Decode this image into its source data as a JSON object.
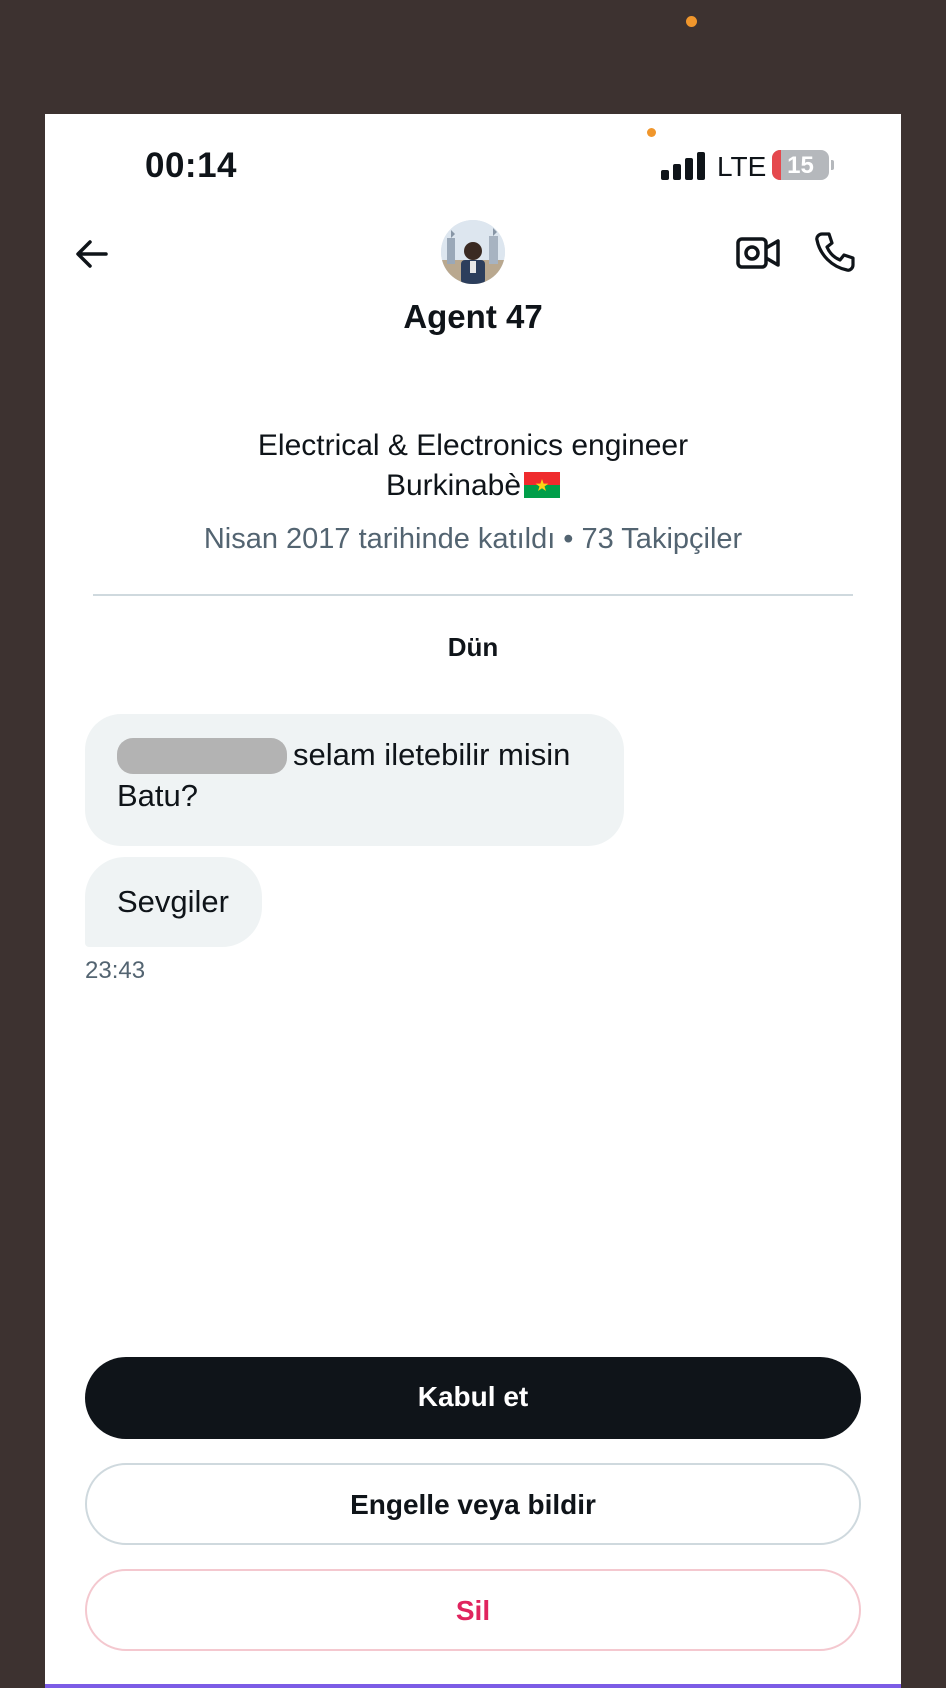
{
  "status_bar": {
    "time": "00:14",
    "network": "LTE",
    "battery_level": "15",
    "battery_fraction": 0.16
  },
  "header": {
    "back_icon": "arrow-left-icon",
    "video_icon": "video-camera-icon",
    "call_icon": "phone-icon",
    "name": "Agent 47"
  },
  "profile": {
    "bio_line1": "Electrical & Electronics engineer",
    "bio_line2": "Burkinabè",
    "flag": "burkina-faso-flag",
    "meta": "Nisan 2017 tarihinde katıldı • 73 Takipçiler"
  },
  "conversation": {
    "day_label": "Dün",
    "messages": [
      {
        "text_line1": "selam iletebilir misin",
        "text_line2": "Batu?",
        "redacted": true
      },
      {
        "text": "Sevgiler"
      }
    ],
    "last_time": "23:43"
  },
  "actions": {
    "accept_label": "Kabul et",
    "block_label": "Engelle veya bildir",
    "delete_label": "Sil"
  },
  "colors": {
    "outer_background": "#3d3230",
    "accent_dot": "#f0962c",
    "primary_button": "#0f1419",
    "delete_text": "#e0245e",
    "bottom_indicator": "#7c5ce6",
    "flag_red": "#ef2b2d",
    "flag_green": "#009e49",
    "flag_star": "#fcd116"
  }
}
